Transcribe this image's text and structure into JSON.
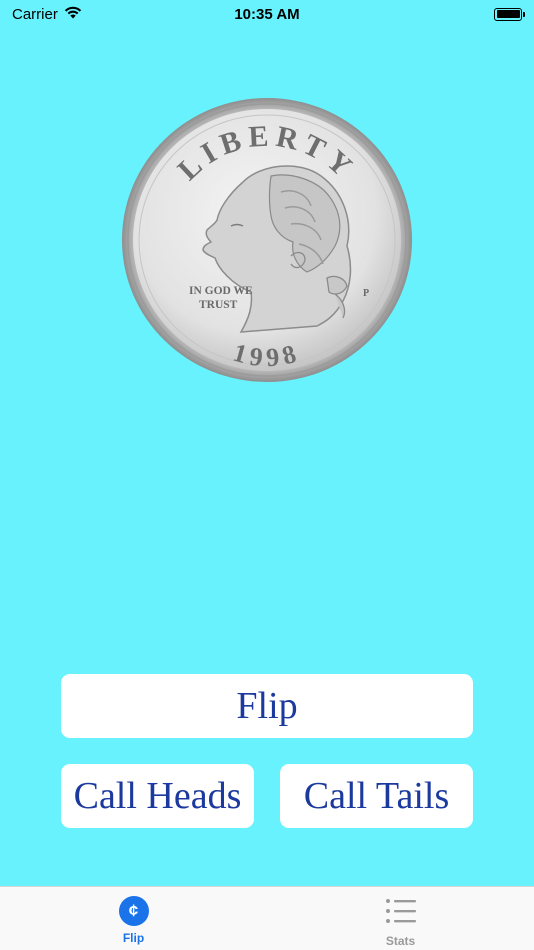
{
  "status_bar": {
    "carrier": "Carrier",
    "time": "10:35 AM",
    "wifi_icon": "wifi-icon",
    "battery_icon": "battery-icon"
  },
  "coin": {
    "legend_top": "LIBERTY",
    "motto_line1": "IN GOD WE",
    "motto_line2": "TRUST",
    "mint_mark": "P",
    "year": "1998",
    "icon": "quarter-coin-heads"
  },
  "buttons": {
    "flip": "Flip",
    "call_heads": "Call Heads",
    "call_tails": "Call Tails"
  },
  "tab_bar": {
    "items": [
      {
        "label": "Flip",
        "icon": "cent-icon",
        "selected": true
      },
      {
        "label": "Stats",
        "icon": "list-icon",
        "selected": false
      }
    ],
    "flip_icon_glyph": "¢"
  },
  "colors": {
    "background": "#67F2FE",
    "button_text": "#1C3A9E",
    "tab_active": "#1A73E8",
    "tab_inactive": "#9A9A9A"
  }
}
